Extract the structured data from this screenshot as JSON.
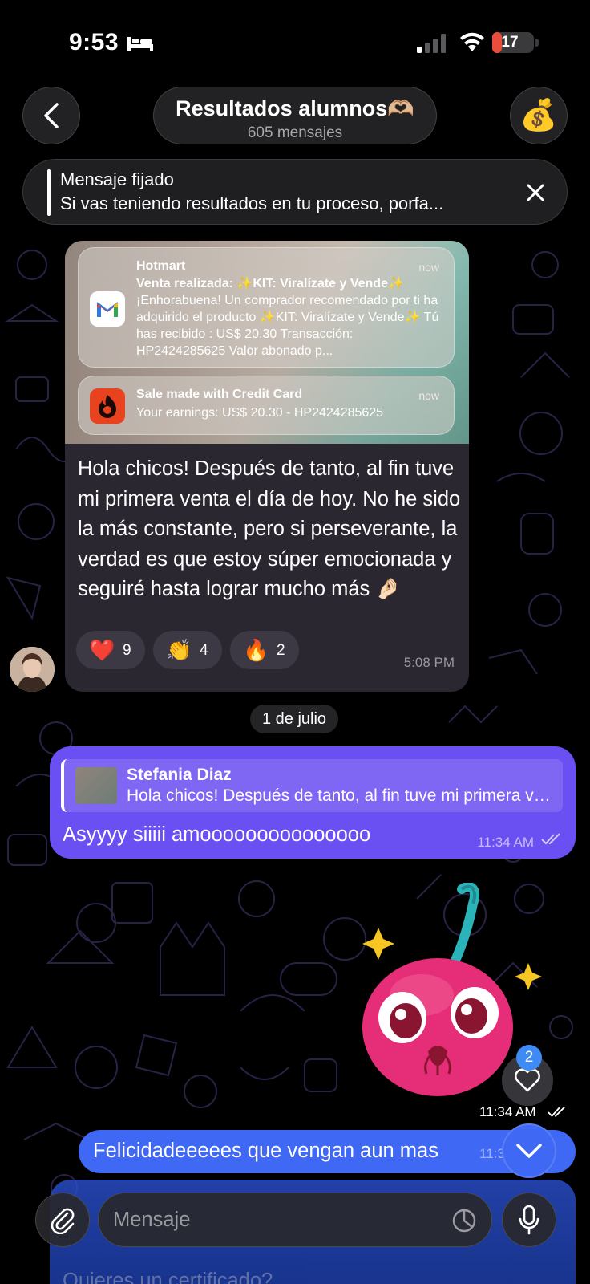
{
  "status_bar": {
    "time": "9:53",
    "battery": "17",
    "battery_level": 0.17
  },
  "header": {
    "title": "Resultados alumnos🫶🏼",
    "subtitle": "605 mensajes",
    "avatar_emoji": "💰"
  },
  "pinned": {
    "title": "Mensaje fijado",
    "text": "Si vas teniendo resultados en tu proceso, porfa..."
  },
  "incoming_message": {
    "notifications": [
      {
        "app": "Hotmart",
        "time": "now",
        "heading": "Venta realizada: ✨KIT: Viralízate y Vende✨",
        "body": "¡Enhorabuena! Un comprador recomendado por ti ha adquirido el producto ✨KIT: Viralízate y Vende✨ Tú has recibido : US$ 20.30 Transacción: HP2424285625 Valor abonado p..."
      },
      {
        "app": "Sale made with Credit Card",
        "time": "now",
        "body": "Your earnings: US$ 20.30 - HP2424285625"
      }
    ],
    "text": "Hola chicos! Después de tanto, al fin tuve mi primera venta el día de hoy. No he sido la más constante, pero si perseverante, la verdad es que estoy súper emocionada y seguiré hasta lograr mucho más 🤌🏻",
    "reactions": [
      {
        "emoji": "❤️",
        "count": "9"
      },
      {
        "emoji": "👏",
        "count": "4"
      },
      {
        "emoji": "🔥",
        "count": "2"
      }
    ],
    "time": "5:08 PM"
  },
  "date_chip": "1 de julio",
  "reply_message": {
    "reply_to_name": "Stefania Diaz",
    "reply_to_text": "Hola chicos! Después de tanto, al fin tuve mi primera venta el día de hoy.",
    "text": "Asyyyy siiiii amooooooooooooooo",
    "time": "11:34 AM"
  },
  "sticker_message": {
    "time": "11:34 AM",
    "badge": "2"
  },
  "blue_message": {
    "text": "Felicidadeeeees que vengan aun mas",
    "time": "11:3"
  },
  "bottom_message": {
    "text": "Quieres un certificado?"
  },
  "composer": {
    "placeholder": "Mensaje"
  },
  "colors": {
    "accent_purple": "#6a4ff2",
    "accent_blue": "#3f68f4",
    "incoming_bubble": "#2a2730",
    "battery_red": "#eb4d3d"
  },
  "icons": [
    "back-icon",
    "bed-icon",
    "signal-icon",
    "wifi-icon",
    "close-icon",
    "heart-icon",
    "chevron-down-icon",
    "paperclip-icon",
    "sticker-icon",
    "microphone-icon",
    "double-check-icon"
  ]
}
